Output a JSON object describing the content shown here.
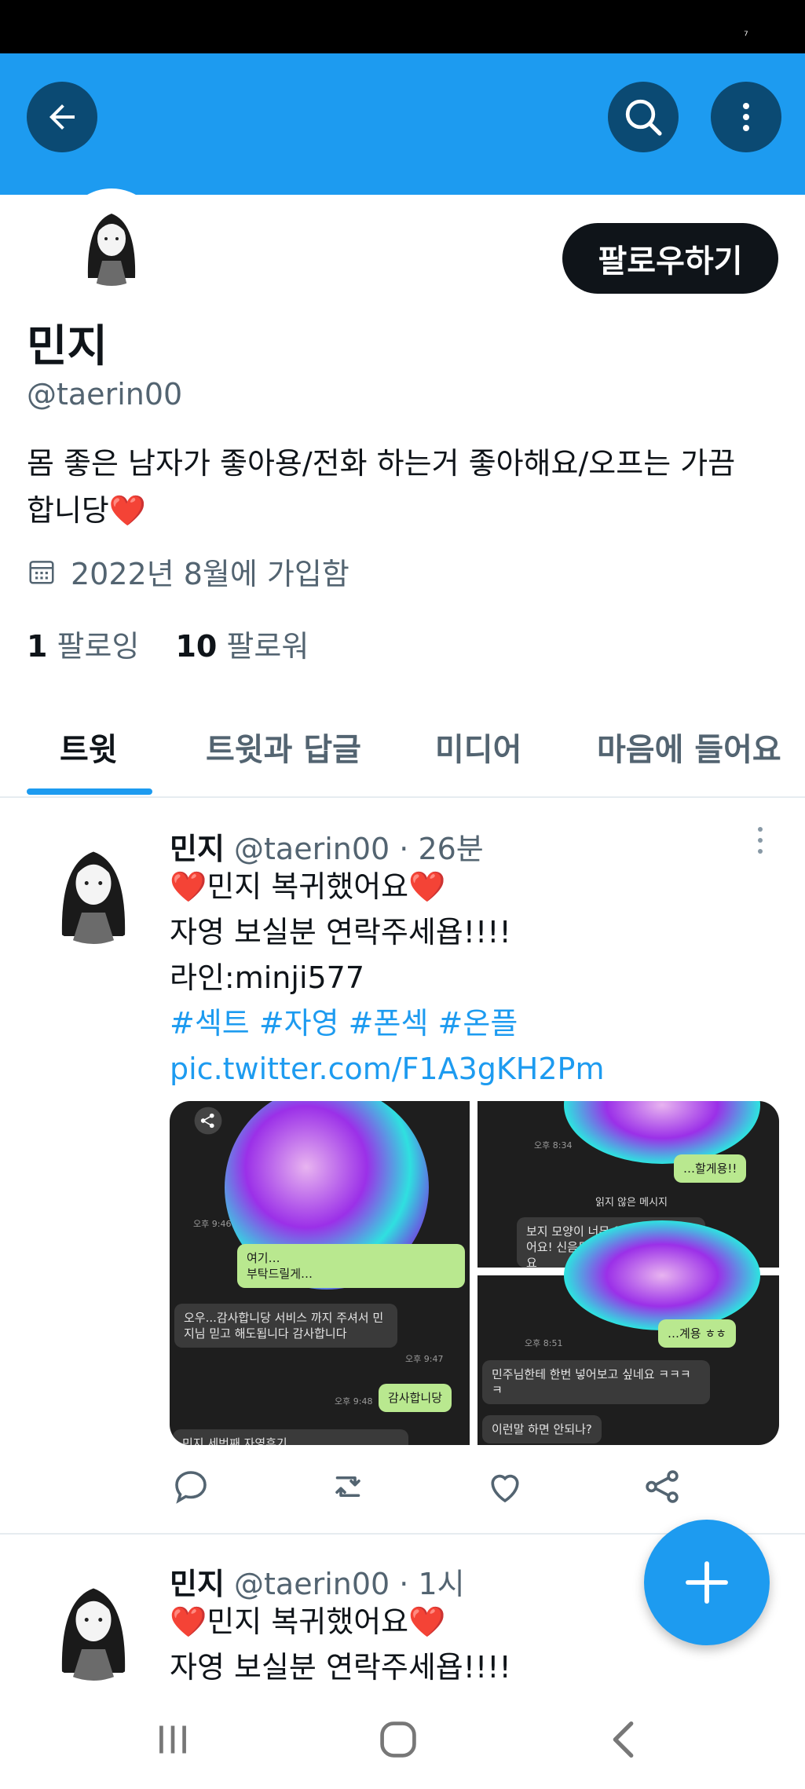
{
  "header": {
    "back_label": "back",
    "search_label": "search",
    "more_label": "more"
  },
  "profile": {
    "name": "민지",
    "handle": "@taerin00",
    "bio": "몸 좋은 남자가 좋아용/전화 하는거 좋아해요/오프는 가끔 합니당",
    "bio_heart": "❤️",
    "joined": "2022년 8월에 가입함",
    "following_count": "1",
    "following_label": "팔로잉",
    "followers_count": "10",
    "followers_label": "팔로워",
    "follow_button": "팔로우하기"
  },
  "tabs": [
    {
      "label": "트윗",
      "active": true
    },
    {
      "label": "트윗과 답글",
      "active": false
    },
    {
      "label": "미디어",
      "active": false
    },
    {
      "label": "마음에 들어요",
      "active": false
    }
  ],
  "tweets": [
    {
      "name": "민지",
      "handle": "@taerin00",
      "time": "· 26분",
      "line1": "❤️민지 복귀했어요❤️",
      "line2": "자영 보실분 연락주세욥!!!!",
      "line3": "라인:minji577",
      "hashtags": "#섹트 #자영 #폰섹 #온플",
      "link": "pic.twitter.com/F1A3gKH2Pm",
      "media_texts": {
        "m1_a": "여기…",
        "m1_b": "부탁드릴게…",
        "m1_c": "오우...감사합니당 서비스 까지 주셔서 민지님 믿고 해도됩니다 감사합니다",
        "m1_d": "감사합니당",
        "m1_t1": "오후 9:46",
        "m1_t2": "오후 9:47",
        "m1_t3": "오후 9:48",
        "m1_e": "민지 세번째 자영후기",
        "m2_a": "…할게용!!",
        "m2_b": "읽지 않은 메시지",
        "m2_c": "보지 모양이 너무 이뻐서 완전 섰어요! 신음도 꼴리고 가슴도 이뻐요",
        "m2_t1": "오후 8:34",
        "m3_a": "…계용 ㅎㅎ",
        "m3_b": "민주님한테 한번 넣어보고 싶네요 ㅋㅋㅋㅋ",
        "m3_c": "이런말 하면 안되나?",
        "m3_t1": "오후 8:51"
      }
    },
    {
      "name": "민지",
      "handle": "@taerin00",
      "time": "· 1시",
      "line1": "❤️민지 복귀했어요❤️",
      "line2": "자영 보실분 연락주세욥!!!!"
    }
  ],
  "colors": {
    "accent": "#1d9bf0",
    "banner": "#1d9bf0",
    "text_secondary": "#536471"
  }
}
